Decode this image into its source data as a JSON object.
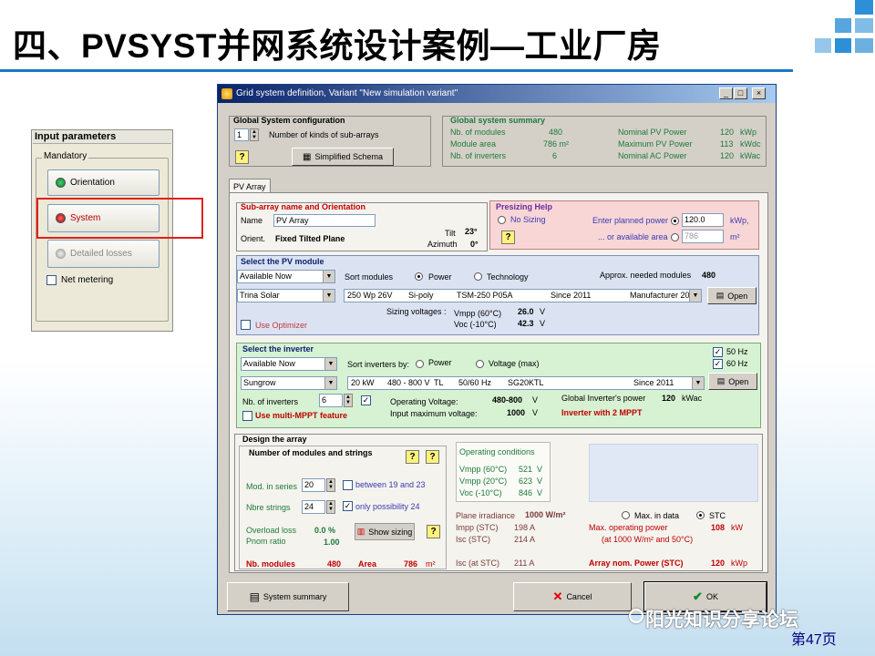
{
  "slide": {
    "title": "四、PVSYST并网系统设计案例—工业厂房",
    "page_label": "第47页",
    "watermark": "阳光知识分享论坛"
  },
  "colors": {
    "accent": "#1b78c8",
    "titlebar": "#0a246a",
    "warning_red": "#c00000",
    "ok_green": "#1e7a3a"
  },
  "input_panel": {
    "header": "Input parameters",
    "group": "Mandatory",
    "buttons": [
      {
        "label": "Orientation",
        "icon": "green-dot-icon"
      },
      {
        "label": "System",
        "icon": "red-dot-icon"
      },
      {
        "label": "Detailed losses",
        "icon": "gray-dot-icon"
      }
    ],
    "net_metering": "Net metering"
  },
  "window": {
    "title": "Grid system definition, Variant  \"New simulation variant\"",
    "global_config": {
      "title": "Global System configuration",
      "kinds_value": "1",
      "kinds_label": "Number of kinds of sub-arrays",
      "schema_button": "Simplified Schema",
      "help": "?"
    },
    "summary": {
      "title": "Global system summary",
      "rows": [
        {
          "l1": "Nb. of modules",
          "v1": "480",
          "l2": "Nominal PV Power",
          "v2": "120",
          "u2": "kWp"
        },
        {
          "l1": "Module area",
          "v1": "786 m²",
          "l2": "Maximum PV Power",
          "v2": "113",
          "u2": "kWdc"
        },
        {
          "l1": "Nb. of inverters",
          "v1": "6",
          "l2": "Nominal AC Power",
          "v2": "120",
          "u2": "kWac"
        }
      ]
    },
    "tab": "PV Array",
    "subarray": {
      "title": "Sub-array name and Orientation",
      "name_label": "Name",
      "name_value": "PV Array",
      "orient_label": "Orient.",
      "orient_value": "Fixed Tilted Plane",
      "tilt_label": "Tilt",
      "tilt_value": "23°",
      "azimuth_label": "Azimuth",
      "azimuth_value": "0°"
    },
    "presizing": {
      "title": "Presizing Help",
      "no_sizing": "No Sizing",
      "planned_label": "Enter planned power",
      "planned_value": "120.0",
      "planned_unit": "kWp,",
      "area_label": "... or available area",
      "area_value": "786",
      "area_unit": "m²",
      "help": "?"
    },
    "pv_module": {
      "title": "Select the PV module",
      "filter": "Available Now",
      "sort_label": "Sort modules",
      "opt_power": "Power",
      "opt_tech": "Technology",
      "needed_label": "Approx. needed modules",
      "needed_value": "480",
      "manufacturer": "Trina Solar",
      "module_desc": [
        "250 Wp 26V",
        "Si-poly",
        "TSM-250 P05A",
        "Since 2011",
        "Manufacturer 20"
      ],
      "open_button": "Open",
      "optimizer": "Use Optimizer",
      "sizing_label": "Sizing voltages :",
      "vmpp_label": "Vmpp (60°C)",
      "vmpp_value": "26.0",
      "voc_label": "Voc  (-10°C)",
      "voc_value": "42.3",
      "unit_v": "V"
    },
    "inverter": {
      "title": "Select the inverter",
      "filter": "Available Now",
      "sort_label": "Sort inverters by:",
      "opt_power": "Power",
      "opt_voltage": "Voltage (max)",
      "hz50": "50 Hz",
      "hz60": "60 Hz",
      "manufacturer": "Sungrow",
      "inv_desc": [
        "20 kW",
        "480 - 800 V",
        "TL",
        "50/60 Hz",
        "SG20KTL",
        "Since 2011"
      ],
      "open_button": "Open",
      "nb_label": "Nb. of inverters",
      "nb_value": "6",
      "opv_label": "Operating Voltage:",
      "opv_value": "480-800",
      "opv_unit": "V",
      "inmax_label": "Input maximum voltage:",
      "inmax_value": "1000",
      "inmax_unit": "V",
      "gpower_label": "Global Inverter's power",
      "gpower_value": "120",
      "gpower_unit": "kWac",
      "multi_mppt": "Use multi-MPPT feature",
      "mppt_note": "Inverter with 2 MPPT"
    },
    "design": {
      "title": "Design the array",
      "group_title": "Number of modules and strings",
      "series_label": "Mod. in series",
      "series_value": "20",
      "between": "between 19 and 23",
      "strings_label": "Nbre strings",
      "strings_value": "24",
      "only_possibility": "only possibility 24",
      "overload_label": "Overload loss",
      "overload_value": "0.0 %",
      "pnom_label": "Pnom ratio",
      "pnom_value": "1.00",
      "show_sizing": "Show sizing",
      "nb_modules_label": "Nb. modules",
      "nb_modules_value": "480",
      "area_label": "Area",
      "area_value": "786",
      "area_unit": "m²",
      "opcond_title": "Operating conditions",
      "opcond": [
        {
          "l": "Vmpp (60°C)",
          "v": "521",
          "u": "V"
        },
        {
          "l": "Vmpp (20°C)",
          "v": "623",
          "u": "V"
        },
        {
          "l": "Voc  (-10°C)",
          "v": "846",
          "u": "V"
        }
      ],
      "irr_label": "Plane irradiance",
      "irr_value": "1000 W/m²",
      "impp_label": "Impp (STC)",
      "impp_value": "198 A",
      "isc_label": "Isc  (STC)",
      "isc_value": "214 A",
      "iscstc_label": "Isc (at STC)",
      "iscstc_value": "211 A",
      "opt_max": "Max. in data",
      "opt_stc": "STC",
      "maxop_label": "Max. operating power",
      "maxop_value": "108",
      "maxop_unit": "kW",
      "maxop_sub": "(at 1000 W/m² and 50°C)",
      "nompower_label": "Array nom. Power (STC)",
      "nompower_value": "120",
      "nompower_unit": "kWp"
    },
    "footer": {
      "summary_button": "System summary",
      "cancel_button": "Cancel",
      "ok_button": "OK"
    }
  }
}
